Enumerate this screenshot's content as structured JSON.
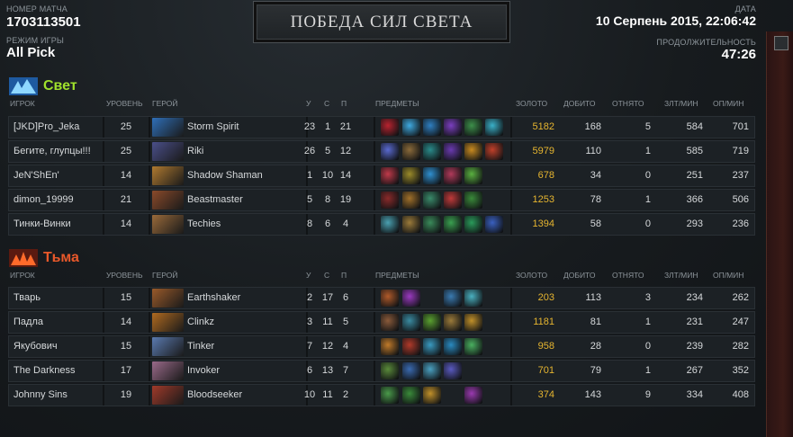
{
  "header": {
    "match_id_label": "НОМЕР МАТЧА",
    "match_id": "1703113501",
    "game_mode_label": "РЕЖИМ ИГРЫ",
    "game_mode": "All Pick",
    "result": "ПОБЕДА СИЛ СВЕТА",
    "date_label": "ДАТА",
    "date": "10 Серпень 2015, 22:06:42",
    "duration_label": "ПРОДОЛЖИТЕЛЬНОСТЬ",
    "duration": "47:26"
  },
  "columns": {
    "player": "ИГРОК",
    "level": "УРОВЕНЬ",
    "hero": "ГЕРОЙ",
    "kills": "У",
    "deaths": "С",
    "assists": "П",
    "items": "ПРЕДМЕТЫ",
    "gold": "ЗОЛОТО",
    "last_hits": "ДОБИТО",
    "denies": "ОТНЯТО",
    "gpm": "ЗЛТ/МИН",
    "xpm": "ОП/МИН"
  },
  "radiant": {
    "name": "Свет",
    "color": "#9fe02c",
    "players": [
      {
        "player": "[JKD]Pro_Jeka",
        "level": "25",
        "hero": "Storm Spirit",
        "k": "23",
        "d": "1",
        "a": "21",
        "gold": "5182",
        "lh": "168",
        "dn": "5",
        "gpm": "584",
        "xpm": "701",
        "portrait": "#2f6fb8",
        "items": [
          "#b8232f",
          "#3fa9e0",
          "#2f7fc0",
          "#7a3fbf",
          "#3d8f4a",
          "#3ab0c8"
        ]
      },
      {
        "player": "Бегите, глупцы!!!",
        "level": "25",
        "hero": "Riki",
        "k": "26",
        "d": "5",
        "a": "12",
        "gold": "5979",
        "lh": "110",
        "dn": "1",
        "gpm": "585",
        "xpm": "719",
        "portrait": "#4a4f8a",
        "items": [
          "#5a6ad0",
          "#8a6a3a",
          "#2a8a8a",
          "#6a3ab0",
          "#c88a20",
          "#c0402a"
        ]
      },
      {
        "player": "JeN'ShEn'",
        "level": "14",
        "hero": "Shadow Shaman",
        "k": "1",
        "d": "10",
        "a": "14",
        "gold": "678",
        "lh": "34",
        "dn": "0",
        "gpm": "251",
        "xpm": "237",
        "portrait": "#b07a30",
        "items": [
          "#c03a4a",
          "#9a8a2a",
          "#2f8fd0",
          "#b03a5a",
          "#5ab040"
        ]
      },
      {
        "player": "dimon_19999",
        "level": "21",
        "hero": "Beastmaster",
        "k": "5",
        "d": "8",
        "a": "19",
        "gold": "1253",
        "lh": "78",
        "dn": "1",
        "gpm": "366",
        "xpm": "506",
        "portrait": "#8a4a2a",
        "items": [
          "#8a2a2a",
          "#a0702a",
          "#3a8a6a",
          "#c03a3a",
          "#3a8a3a"
        ]
      },
      {
        "player": "Тинки-Винки",
        "level": "14",
        "hero": "Techies",
        "k": "8",
        "d": "6",
        "a": "4",
        "gold": "1394",
        "lh": "58",
        "dn": "0",
        "gpm": "293",
        "xpm": "236",
        "portrait": "#9a6a3a",
        "items": [
          "#4aa0b0",
          "#9a7a3a",
          "#3a8a5a",
          "#3aa050",
          "#2a9a5a",
          "#3a60c0"
        ]
      }
    ]
  },
  "dire": {
    "name": "Тьма",
    "color": "#e8582a",
    "players": [
      {
        "player": "Тварь",
        "level": "15",
        "hero": "Earthshaker",
        "k": "2",
        "d": "17",
        "a": "6",
        "gold": "203",
        "lh": "113",
        "dn": "3",
        "gpm": "234",
        "xpm": "262",
        "portrait": "#9a5a2a",
        "items": [
          "#b05a2a",
          "#9a3ac0",
          "",
          "#3a7ab0",
          "#4ab0c0"
        ]
      },
      {
        "player": "Падла",
        "level": "14",
        "hero": "Clinkz",
        "k": "3",
        "d": "11",
        "a": "5",
        "gold": "1181",
        "lh": "81",
        "dn": "1",
        "gpm": "231",
        "xpm": "247",
        "portrait": "#b06a20",
        "items": [
          "#8a5a3a",
          "#3a8aa0",
          "#5aa030",
          "#9a7a3a",
          "#c0902a"
        ]
      },
      {
        "player": "Якубович",
        "level": "15",
        "hero": "Tinker",
        "k": "7",
        "d": "12",
        "a": "4",
        "gold": "958",
        "lh": "28",
        "dn": "0",
        "gpm": "239",
        "xpm": "282",
        "portrait": "#5a7ab0",
        "items": [
          "#c07a2a",
          "#b03a2a",
          "#3a9ac0",
          "#2a8ac0",
          "#4ab060"
        ]
      },
      {
        "player": "The Darkness",
        "level": "17",
        "hero": "Invoker",
        "k": "6",
        "d": "13",
        "a": "7",
        "gold": "701",
        "lh": "79",
        "dn": "1",
        "gpm": "267",
        "xpm": "352",
        "portrait": "#9a6a8a",
        "items": [
          "#5a8a3a",
          "#3a6ab0",
          "#4aa0c0",
          "#5a5ac0"
        ]
      },
      {
        "player": "Johnny Sins",
        "level": "19",
        "hero": "Bloodseeker",
        "k": "10",
        "d": "11",
        "a": "2",
        "gold": "374",
        "lh": "143",
        "dn": "9",
        "gpm": "334",
        "xpm": "408",
        "portrait": "#a03a2a",
        "items": [
          "#4a9a4a",
          "#3a8a3a",
          "#c0902a",
          "",
          "#9a3ab0"
        ]
      }
    ]
  }
}
